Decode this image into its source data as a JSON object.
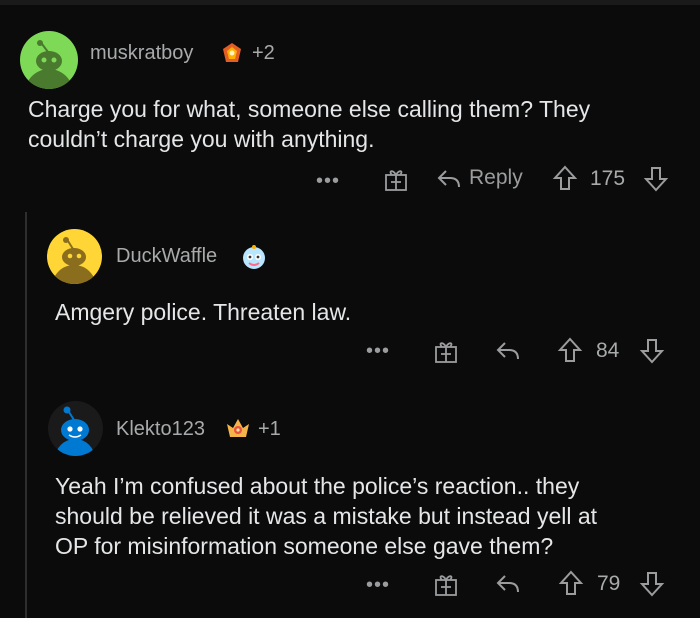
{
  "comments": [
    {
      "username": "muskratboy",
      "award_count": "+2",
      "text_lines": [
        "Charge you for what, someone else calling them? They",
        "couldn’t charge you with anything."
      ],
      "actions": {
        "more": "•••",
        "reply_label": "Reply",
        "score": "175"
      },
      "avatar_color": "#7ed957"
    },
    {
      "username": "DuckWaffle",
      "award_count": "",
      "text_lines": [
        "Amgery police. Threaten law."
      ],
      "actions": {
        "more": "•••",
        "reply_label": "",
        "score": "84"
      },
      "avatar_color": "#ffd635"
    },
    {
      "username": "Klekto123",
      "award_count": "+1",
      "text_lines": [
        "Yeah I’m confused about the police’s reaction.. they",
        "should be relieved it was a mistake but instead yell at",
        "OP for misinformation someone else gave them?"
      ],
      "actions": {
        "more": "•••",
        "reply_label": "",
        "score": "79"
      },
      "avatar_color": "#0079d3"
    }
  ],
  "icons": [
    "award-icon",
    "reply-icon",
    "upvote-icon",
    "downvote-icon",
    "more-icon",
    "snoo-avatar-icon"
  ]
}
